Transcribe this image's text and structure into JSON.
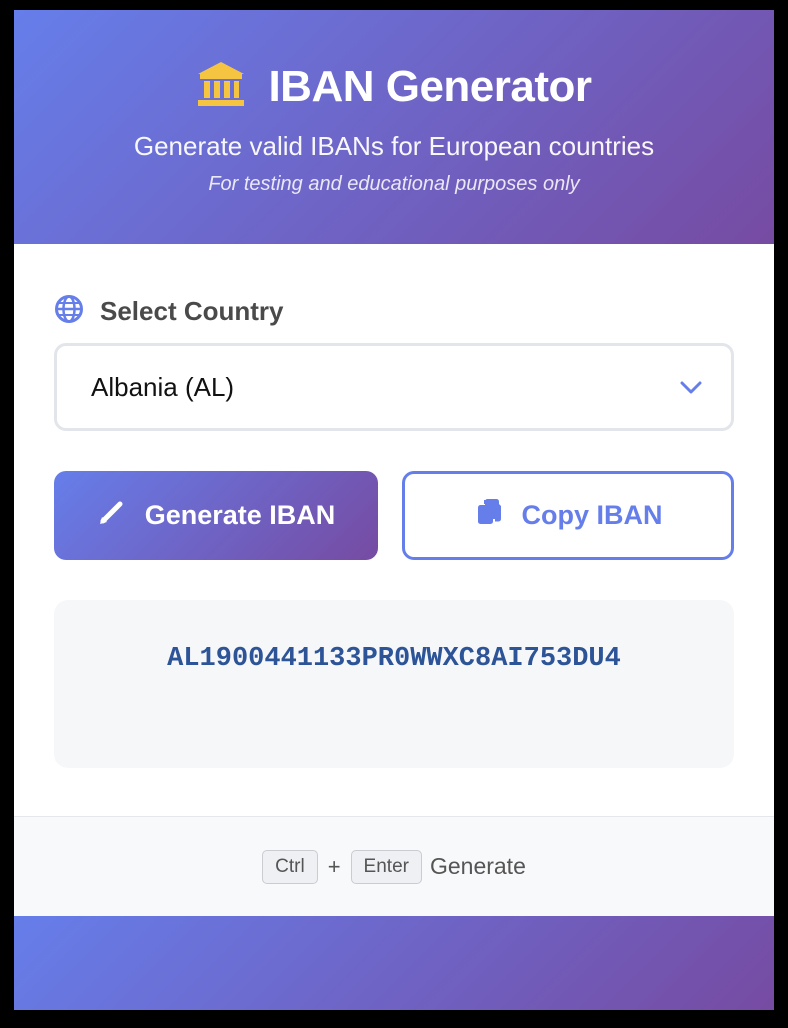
{
  "header": {
    "title": "IBAN Generator",
    "subtitle": "Generate valid IBANs for European countries",
    "note": "For testing and educational purposes only",
    "title_icon": "bank-icon"
  },
  "form": {
    "country_label": "Select Country",
    "country_icon": "globe-icon",
    "selected_country": "Albania (AL)"
  },
  "actions": {
    "generate_label": "Generate IBAN",
    "copy_label": "Copy IBAN",
    "generate_icon": "pencil-icon",
    "copy_icon": "copy-icon"
  },
  "result": {
    "iban": "AL1900441133PR0WWXC8AI753DU4"
  },
  "shortcut": {
    "key1": "Ctrl",
    "plus": "+",
    "key2": "Enter",
    "action": "Generate"
  },
  "colors": {
    "accent_start": "#667eea",
    "accent_end": "#764ba2",
    "iban_text": "#2d5497",
    "bank_icon": "#f5c542"
  }
}
